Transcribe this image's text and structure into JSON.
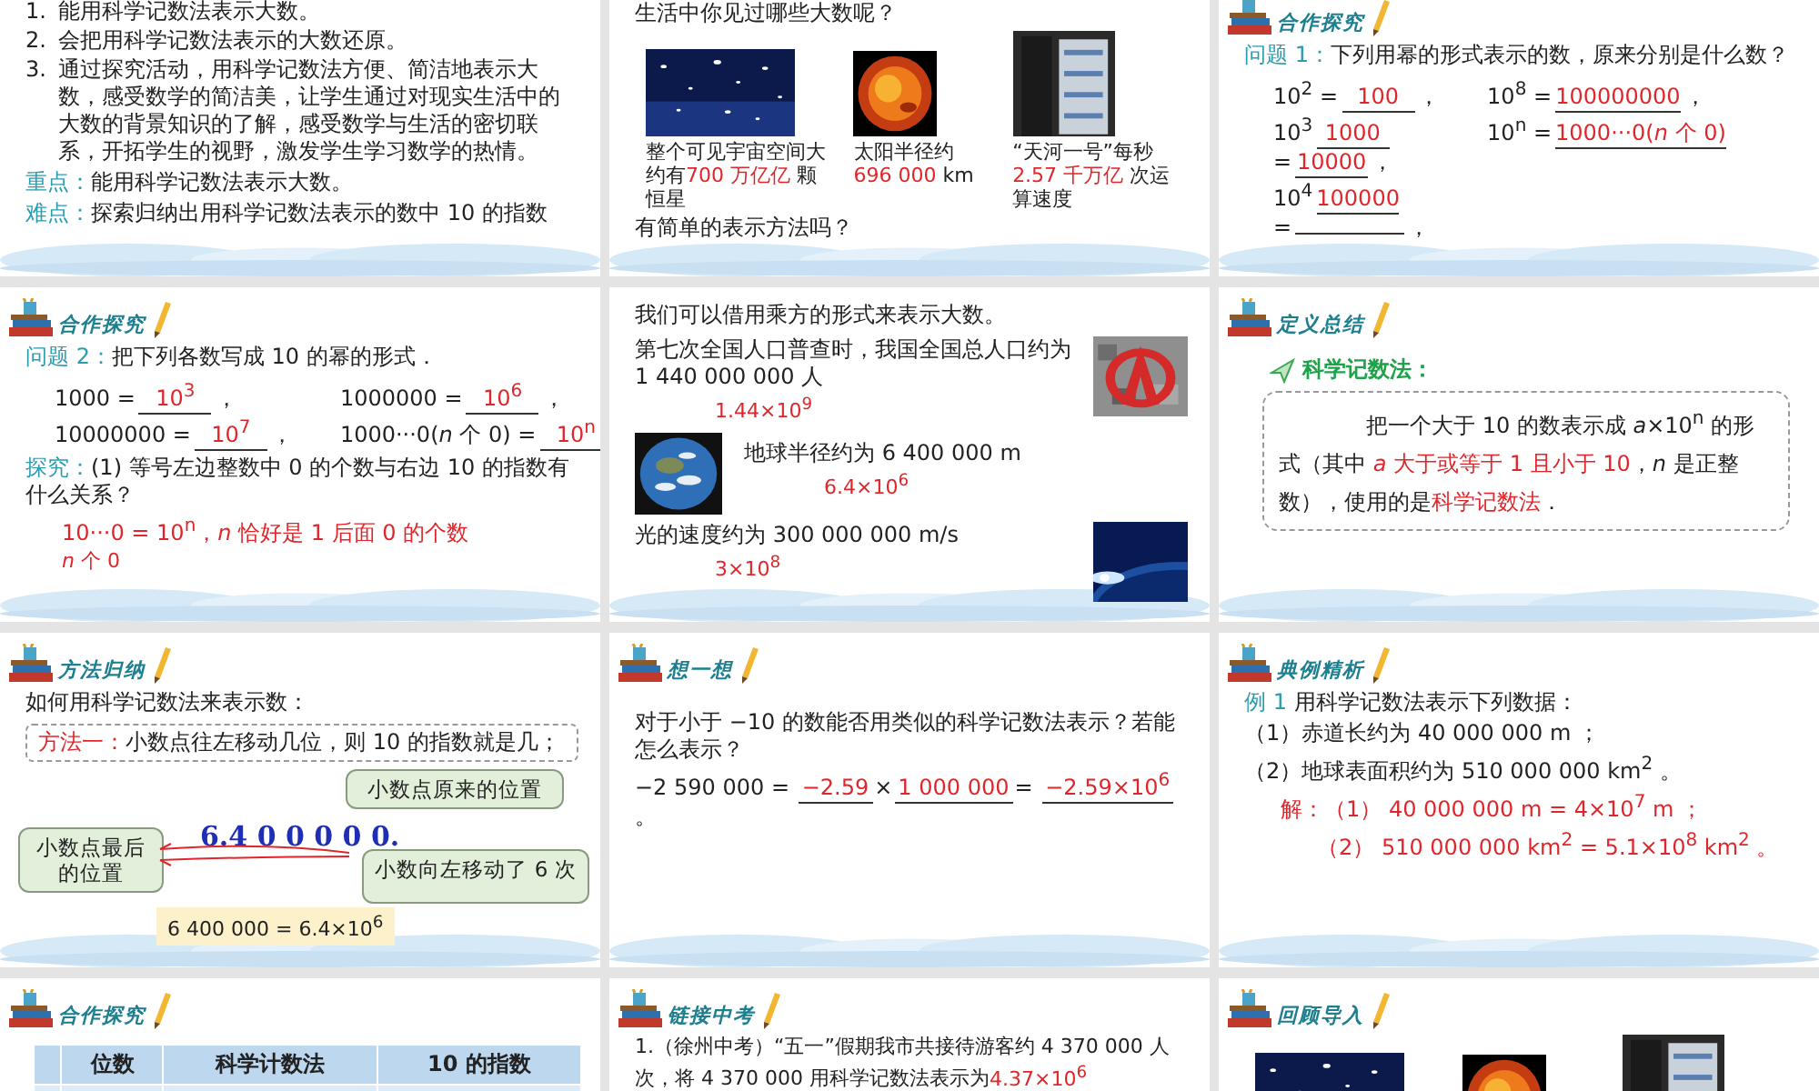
{
  "slides": [
    {
      "blocks": [
        {
          "kind": "item",
          "marker": "1.",
          "segments": [
            {
              "text": "能用科学记数法表示大数。"
            }
          ]
        },
        {
          "kind": "item",
          "marker": "2.",
          "segments": [
            {
              "text": "会把用科学记数法表示的大数还原。"
            }
          ]
        },
        {
          "kind": "item",
          "marker": "3.",
          "segments": [
            {
              "text": "通过探究活动，用科学记数法方便、简洁地表示大数，感受数学的简洁美，让学生通过对现实生活中的大数的背景知识的了解，感受数学与生活的密切联系，开拓学生的视野，激发学生学习数学的热情。"
            }
          ]
        },
        {
          "kind": "para",
          "segments": [
            {
              "text": "重点：",
              "kind": "label"
            },
            {
              "text": "能用科学记数法表示大数。"
            }
          ]
        },
        {
          "kind": "para",
          "segments": [
            {
              "text": "难点：",
              "kind": "label"
            },
            {
              "text": "探索归纳出用科学记数法表示的数中 10 的指数"
            }
          ]
        }
      ]
    },
    {
      "blocks": [
        {
          "kind": "para",
          "segments": [
            {
              "text": "生活中你见过哪些大数呢？"
            }
          ]
        },
        {
          "kind": "figures",
          "figures": [
            {
              "kind": "picture",
              "caption": [
                {
                  "text": "整个可见宇宙空间大约有"
                },
                {
                  "text": "700 万亿亿",
                  "kind": "highlight"
                },
                {
                  "text": " 颗恒星"
                }
              ]
            },
            {
              "kind": "picture",
              "caption": [
                {
                  "text": "太阳半径约 "
                },
                {
                  "text": "696 000",
                  "kind": "highlight"
                },
                {
                  "text": " km"
                }
              ]
            },
            {
              "kind": "picture",
              "caption": [
                {
                  "text": "“天河一号”每秒 "
                },
                {
                  "text": "2.57 千万亿",
                  "kind": "highlight"
                },
                {
                  "text": " 次运算速度"
                }
              ]
            }
          ]
        },
        {
          "kind": "para",
          "segments": [
            {
              "text": "有简单的表示方法吗？"
            }
          ]
        }
      ]
    },
    {
      "heading": "合作探究",
      "blocks": [
        {
          "kind": "para",
          "segments": [
            {
              "text": "问题 1：",
              "kind": "label"
            },
            {
              "text": "下列用幂的形式表示的数，原来分别是什么数？"
            }
          ]
        },
        {
          "kind": "equations",
          "columns": [
            [
              {
                "lhs": "10$^{2}$ =",
                "answer": "100",
                "suffix": "，"
              },
              {
                "lhs": "10$^{3}$",
                "answer": "1000"
              },
              {
                "lhs": "=",
                "answer": "10000",
                "suffix": "，"
              },
              {
                "lhs": "10$^{4}$",
                "answer": "100000"
              },
              {
                "lhs": "=",
                "suffix": "，"
              }
            ],
            [
              {
                "lhs": "10$^{8}$ =",
                "answer": "100000000",
                "suffix": "，"
              },
              {
                "lhs": "10$^{n}$ =",
                "answer": "1000···0(*n* 个 0)"
              }
            ]
          ]
        }
      ]
    },
    {
      "heading": "合作探究",
      "blocks": [
        {
          "kind": "para",
          "segments": [
            {
              "text": "问题 2：",
              "kind": "label"
            },
            {
              "text": "把下列各数写成 10 的幂的形式．"
            }
          ]
        },
        {
          "kind": "equations",
          "columns": [
            [
              {
                "lhs": "1000 =",
                "answer": "10$^{3}$",
                "suffix": "，"
              },
              {
                "lhs": "10000000 =",
                "answer": "10$^{7}$",
                "suffix": "，"
              }
            ],
            [
              {
                "lhs": "1000000 =",
                "answer": "10$^{6}$",
                "suffix": "，"
              },
              {
                "lhs": "1000···0(*n* 个 0) =",
                "answer": "10$^{n}$"
              }
            ]
          ]
        },
        {
          "kind": "para",
          "segments": [
            {
              "text": "探究：",
              "kind": "label"
            },
            {
              "text": "(1) 等号左边整数中 0 的个数与右边 10 的指数有什么关系？"
            }
          ]
        },
        {
          "kind": "answer-line",
          "segments": [
            {
              "text": "10···0 = 10$^{n}$，*n* 恰好是 1 后面 0 的个数"
            }
          ]
        },
        {
          "kind": "note",
          "segments": [
            {
              "text": "*n* 个 0"
            }
          ]
        }
      ]
    },
    {
      "blocks": [
        {
          "kind": "para",
          "segments": [
            {
              "text": "我们可以借用乘方的形式来表示大数。"
            }
          ]
        },
        {
          "kind": "media-right",
          "segments": [
            {
              "text": "第七次全国人口普查时，我国全国总人口约为 1 440 000 000 人"
            }
          ],
          "result": "1.44×10$^{9}$"
        },
        {
          "kind": "media-left",
          "segments": [
            {
              "text": "地球半径约为 6 400 000 m"
            }
          ],
          "result": "6.4×10$^{6}$"
        },
        {
          "kind": "media-right",
          "segments": [
            {
              "text": "光的速度约为 300 000 000 m/s"
            }
          ],
          "result": "3×10$^{8}$"
        }
      ]
    },
    {
      "heading": "定义总结",
      "blocks": [
        {
          "kind": "term",
          "segments": [
            {
              "text": "科学记数法："
            }
          ]
        },
        {
          "kind": "definition",
          "segments": [
            {
              "text": "把一个大于 10 的数表示成 *a*×10$^{n}$ 的形式（其中 "
            },
            {
              "text": "*a* 大于或等于 1 且小于 10",
              "kind": "highlight"
            },
            {
              "text": "，*n* 是正整数），使用的是"
            },
            {
              "text": "科学记数法",
              "kind": "highlight"
            },
            {
              "text": "．"
            }
          ]
        }
      ]
    },
    {
      "heading": "方法归纳",
      "blocks": [
        {
          "kind": "para",
          "segments": [
            {
              "text": "如何用科学记数法来表示数："
            }
          ]
        },
        {
          "kind": "boxed",
          "segments": [
            {
              "text": "方法一：",
              "kind": "highlight"
            },
            {
              "text": "小数点往左移动几位，则 10 的指数就是几；"
            }
          ]
        },
        {
          "kind": "shift-diagram",
          "number": "6.4 0 0 0 0 0.",
          "callouts": [
            "小数点原来的位置",
            "小数点最后的位置",
            "小数向左移动了 6 次"
          ],
          "result": "6 400 000 = 6.4×10$^{6}$"
        }
      ]
    },
    {
      "heading": "想一想",
      "blocks": [
        {
          "kind": "para",
          "segments": [
            {
              "text": "对于小于 −10 的数能否用类似的科学记数法表示？若能怎么表示？"
            }
          ]
        },
        {
          "kind": "para",
          "segments": [
            {
              "text": "−2 590 000 = "
            },
            {
              "text": "−2.59",
              "kind": "fill-in"
            },
            {
              "text": "×"
            },
            {
              "text": "1 000 000",
              "kind": "fill-in"
            },
            {
              "text": "= "
            },
            {
              "text": "−2.59×10$^{6}$",
              "kind": "fill-in"
            },
            {
              "text": " 。"
            }
          ]
        }
      ]
    },
    {
      "heading": "典例精析",
      "blocks": [
        {
          "kind": "para",
          "segments": [
            {
              "text": "例 1 ",
              "kind": "label"
            },
            {
              "text": "用科学记数法表示下列数据："
            }
          ]
        },
        {
          "kind": "para",
          "segments": [
            {
              "text": "（1）赤道长约为 40 000 000 m ；"
            }
          ]
        },
        {
          "kind": "para",
          "segments": [
            {
              "text": "（2）地球表面积约为 510 000 000 km$^{2}$ 。"
            }
          ]
        },
        {
          "kind": "answer-line",
          "segments": [
            {
              "text": "解：（1） 40 000 000 m = 4×10$^{7}$ m ；"
            }
          ]
        },
        {
          "kind": "answer-indented",
          "segments": [
            {
              "text": "（2） 510 000 000 km$^{2}$ = 5.1×10$^{8}$ km$^{2}$ 。"
            }
          ]
        }
      ]
    },
    {
      "heading": "合作探究",
      "blocks": [
        {
          "kind": "table",
          "columns": [
            "位数",
            "科学计数法",
            "10 的指数"
          ]
        }
      ]
    },
    {
      "heading": "链接中考",
      "blocks": [
        {
          "kind": "small-para",
          "segments": [
            {
              "text": "1.（徐州中考）“五一”假期我市共接待游客约 4 370 000 人次，将 4 370 000 用科学记数法表示为"
            },
            {
              "text": "4.37×10$^{6}$",
              "kind": "highlight"
            }
          ]
        }
      ]
    },
    {
      "heading": "回顾导入",
      "blocks": [
        {
          "kind": "figures"
        }
      ]
    }
  ]
}
